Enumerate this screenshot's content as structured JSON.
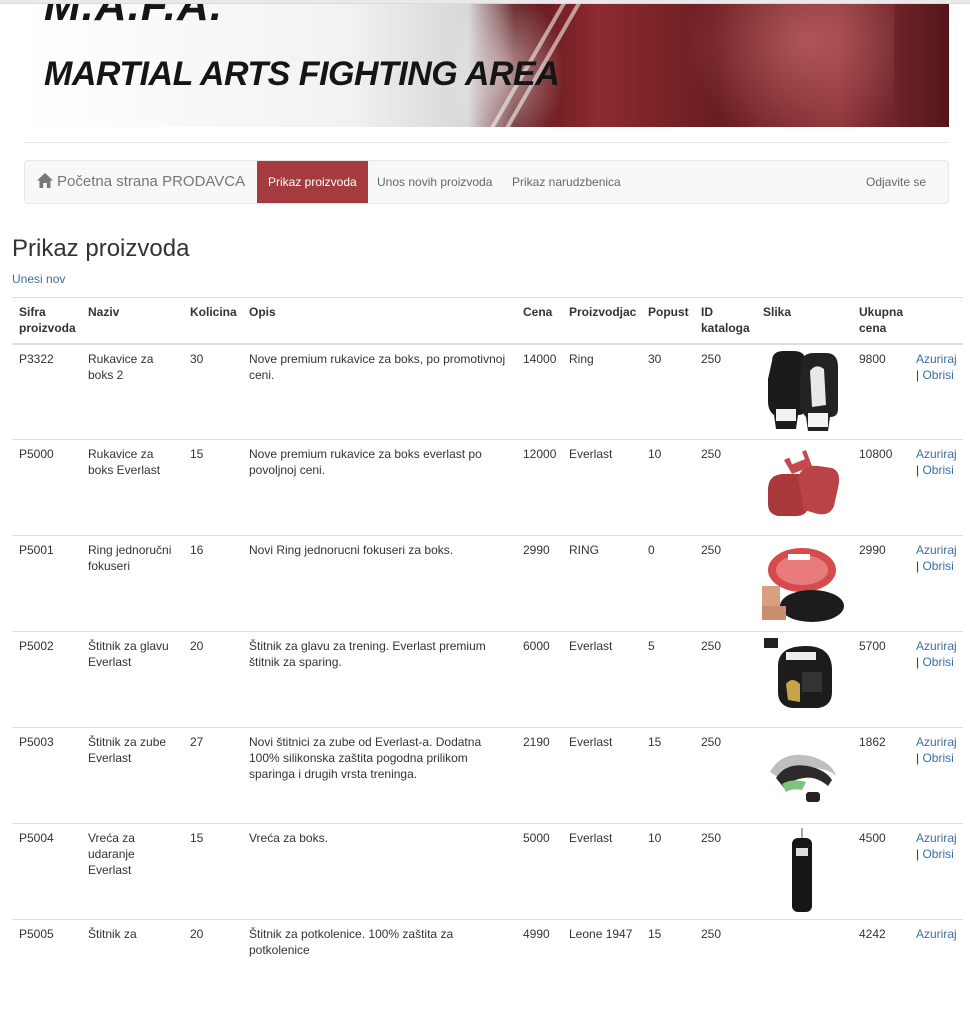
{
  "banner": {
    "line1": "M.A.F.A.",
    "line2": "MARTIAL ARTS FIGHTING AREA"
  },
  "nav": {
    "brand": "Početna strana PRODAVCA",
    "items": [
      {
        "label": "Prikaz proizvoda",
        "active": true
      },
      {
        "label": "Unos novih proizvoda",
        "active": false
      },
      {
        "label": "Prikaz narudzbenica",
        "active": false
      }
    ],
    "logout": "Odjavite se"
  },
  "page": {
    "title": "Prikaz proizvoda",
    "new_link": "Unesi nov"
  },
  "table": {
    "headers": [
      "Sifra proizvoda",
      "Naziv",
      "Kolicina",
      "Opis",
      "Cena",
      "Proizvodjac",
      "Popust",
      "ID kataloga",
      "Slika",
      "Ukupna cena",
      ""
    ],
    "rows": [
      {
        "sifra": "P3322",
        "naziv": "Rukavice za boks 2",
        "kolicina": "30",
        "opis": "Nove premium rukavice za boks, po promotivnoj ceni.",
        "cena": "14000",
        "proizvodjac": "Ring",
        "popust": "30",
        "id_kataloga": "250",
        "slika": "black-white-boxing-gloves",
        "ukupna": "9800",
        "edit": "Azuriraj",
        "sep": "|",
        "delete": "Obrisi"
      },
      {
        "sifra": "P5000",
        "naziv": "Rukavice za boks Everlast",
        "kolicina": "15",
        "opis": "Nove premium rukavice za boks everlast po povoljnoj ceni.",
        "cena": "12000",
        "proizvodjac": "Everlast",
        "popust": "10",
        "id_kataloga": "250",
        "slika": "red-boxing-gloves",
        "ukupna": "10800",
        "edit": "Azuriraj",
        "sep": "|",
        "delete": "Obrisi"
      },
      {
        "sifra": "P5001",
        "naziv": "Ring jednoručni fokuseri",
        "kolicina": "16",
        "opis": "Novi Ring jednorucni fokuseri za boks.",
        "cena": "2990",
        "proizvodjac": "RING",
        "popust": "0",
        "id_kataloga": "250",
        "slika": "focus-mitts",
        "ukupna": "2990",
        "edit": "Azuriraj",
        "sep": "|",
        "delete": "Obrisi"
      },
      {
        "sifra": "P5002",
        "naziv": "Štitnik za glavu Everlast",
        "kolicina": "20",
        "opis": "Štitnik za glavu za trening. Everlast premium štitnik za sparing.",
        "cena": "6000",
        "proizvodjac": "Everlast",
        "popust": "5",
        "id_kataloga": "250",
        "slika": "head-guard",
        "ukupna": "5700",
        "edit": "Azuriraj",
        "sep": "|",
        "delete": "Obrisi"
      },
      {
        "sifra": "P5003",
        "naziv": "Štitnik za zube Everlast",
        "kolicina": "27",
        "opis": "Novi štitnici za zube od Everlast-a. Dodatna 100% silikonska zaštita pogodna prilikom sparinga i drugih vrsta treninga.",
        "cena": "2190",
        "proizvodjac": "Everlast",
        "popust": "15",
        "id_kataloga": "250",
        "slika": "mouth-guard",
        "ukupna": "1862",
        "edit": "Azuriraj",
        "sep": "|",
        "delete": "Obrisi"
      },
      {
        "sifra": "P5004",
        "naziv": "Vreća za udaranje Everlast",
        "kolicina": "15",
        "opis": "Vreća za boks.",
        "cena": "5000",
        "proizvodjac": "Everlast",
        "popust": "10",
        "id_kataloga": "250",
        "slika": "punching-bag",
        "ukupna": "4500",
        "edit": "Azuriraj",
        "sep": "|",
        "delete": "Obrisi"
      },
      {
        "sifra": "P5005",
        "naziv": "Štitnik za",
        "kolicina": "20",
        "opis": "Štitnik za potkolenice. 100% zaštita za potkolenice",
        "cena": "4990",
        "proizvodjac": "Leone 1947",
        "popust": "15",
        "id_kataloga": "250",
        "slika": "shin-guard",
        "ukupna": "4242",
        "edit": "Azuriraj",
        "sep": "",
        "delete": ""
      }
    ]
  }
}
